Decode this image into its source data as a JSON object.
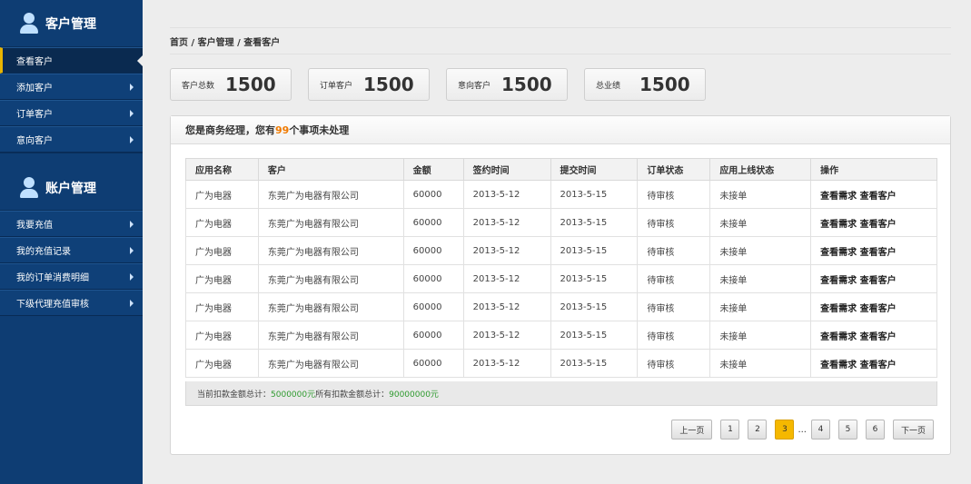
{
  "sidebar": {
    "section1": {
      "title": "客户管理",
      "icon": "user-icon"
    },
    "items1": [
      {
        "label": "查看客户",
        "active": true
      },
      {
        "label": "添加客户"
      },
      {
        "label": "订单客户"
      },
      {
        "label": "意向客户"
      }
    ],
    "section2": {
      "title": "账户管理",
      "icon": "user-icon"
    },
    "items2": [
      {
        "label": "我要充值"
      },
      {
        "label": "我的充值记录"
      },
      {
        "label": "我的订单消费明细"
      },
      {
        "label": "下级代理充值审核"
      }
    ]
  },
  "breadcrumb": "首页 / 客户管理 / 查看客户",
  "stats": [
    {
      "label": "客户总数",
      "value": "1500"
    },
    {
      "label": "订单客户",
      "value": "1500"
    },
    {
      "label": "意向客户",
      "value": "1500"
    },
    {
      "label": "总业绩",
      "value": "1500"
    }
  ],
  "panel": {
    "head_prefix": "您是商务经理，您有",
    "head_count": "99",
    "head_suffix": "个事项未处理"
  },
  "table": {
    "headers": [
      "应用名称",
      "客户",
      "金额",
      "签约时间",
      "提交时间",
      "订单状态",
      "应用上线状态",
      "操作"
    ],
    "rows": [
      [
        "广为电器",
        "东莞广为电器有限公司",
        "60000",
        "2013-5-12",
        "2013-5-15",
        "待审核",
        "未接单",
        "查看需求 查看客户"
      ],
      [
        "广为电器",
        "东莞广为电器有限公司",
        "60000",
        "2013-5-12",
        "2013-5-15",
        "待审核",
        "未接单",
        "查看需求 查看客户"
      ],
      [
        "广为电器",
        "东莞广为电器有限公司",
        "60000",
        "2013-5-12",
        "2013-5-15",
        "待审核",
        "未接单",
        "查看需求 查看客户"
      ],
      [
        "广为电器",
        "东莞广为电器有限公司",
        "60000",
        "2013-5-12",
        "2013-5-15",
        "待审核",
        "未接单",
        "查看需求 查看客户"
      ],
      [
        "广为电器",
        "东莞广为电器有限公司",
        "60000",
        "2013-5-12",
        "2013-5-15",
        "待审核",
        "未接单",
        "查看需求 查看客户"
      ],
      [
        "广为电器",
        "东莞广为电器有限公司",
        "60000",
        "2013-5-12",
        "2013-5-15",
        "待审核",
        "未接单",
        "查看需求 查看客户"
      ],
      [
        "广为电器",
        "东莞广为电器有限公司",
        "60000",
        "2013-5-12",
        "2013-5-15",
        "待审核",
        "未接单",
        "查看需求 查看客户"
      ]
    ]
  },
  "summary": {
    "label1": "当前扣款金额总计：",
    "value1": "5000000元",
    "label2": " 所有扣款金额总计：",
    "value2": "90000000元"
  },
  "pager": {
    "prev": "上一页",
    "pages": [
      "1",
      "2",
      "3",
      "4",
      "5",
      "6"
    ],
    "current": "3",
    "ellipsis": "...",
    "next": "下一页"
  },
  "colors": {
    "sidebar": "#0e3d73",
    "accent": "#f5b800",
    "count": "#f07a00",
    "money": "#2e9a2e"
  }
}
